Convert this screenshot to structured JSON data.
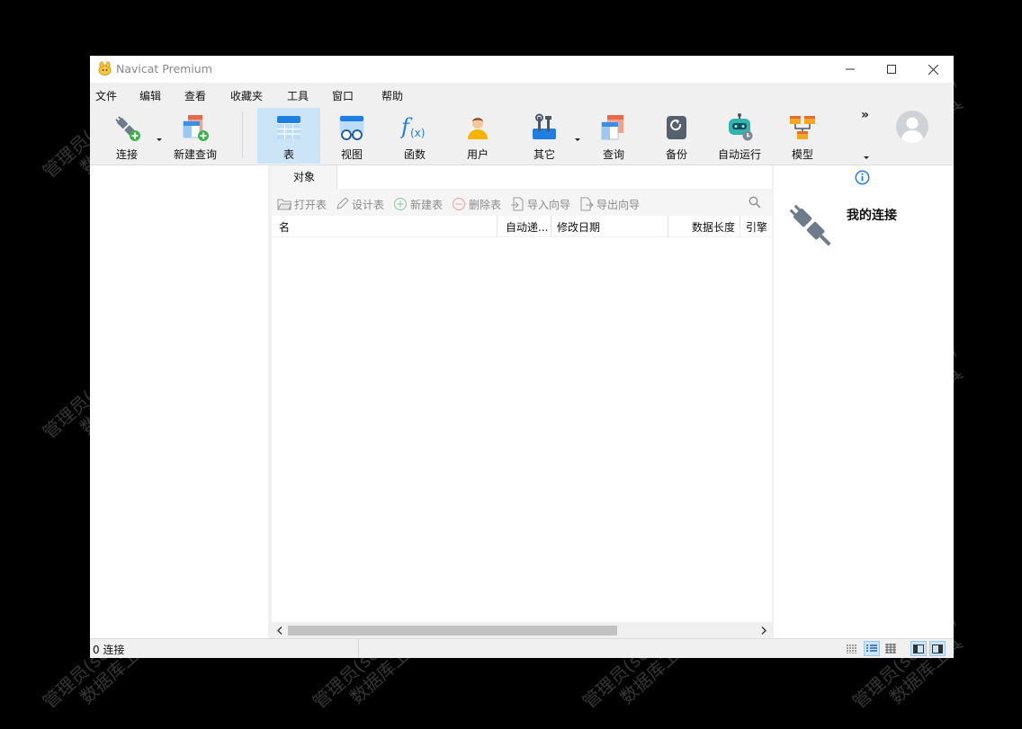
{
  "window": {
    "title": "Navicat Premium"
  },
  "menu": [
    "文件",
    "编辑",
    "查看",
    "收藏夹",
    "工具",
    "窗口",
    "帮助"
  ],
  "toolbar": {
    "connect": "连接",
    "new_query": "新建查询",
    "table": "表",
    "view": "视图",
    "function": "函数",
    "user": "用户",
    "other": "其它",
    "query": "查询",
    "backup": "备份",
    "automation": "自动运行",
    "model": "模型",
    "more": "»"
  },
  "tabs": {
    "objects": "对象"
  },
  "object_toolbar": {
    "open_table": "打开表",
    "design_table": "设计表",
    "new_table": "新建表",
    "delete_table": "删除表",
    "import_wizard": "导入向导",
    "export_wizard": "导出向导"
  },
  "grid": {
    "columns": [
      "名",
      "自动递...",
      "修改日期",
      "数据长度",
      "引擎"
    ]
  },
  "info_panel": {
    "title": "我的连接"
  },
  "status": {
    "connections": "0 连接"
  },
  "watermark": {
    "line1": "管理员(schany)",
    "line2": "数据库工具"
  },
  "colors": {
    "accent": "#0078d7",
    "active_tab": "#cce4f7"
  }
}
